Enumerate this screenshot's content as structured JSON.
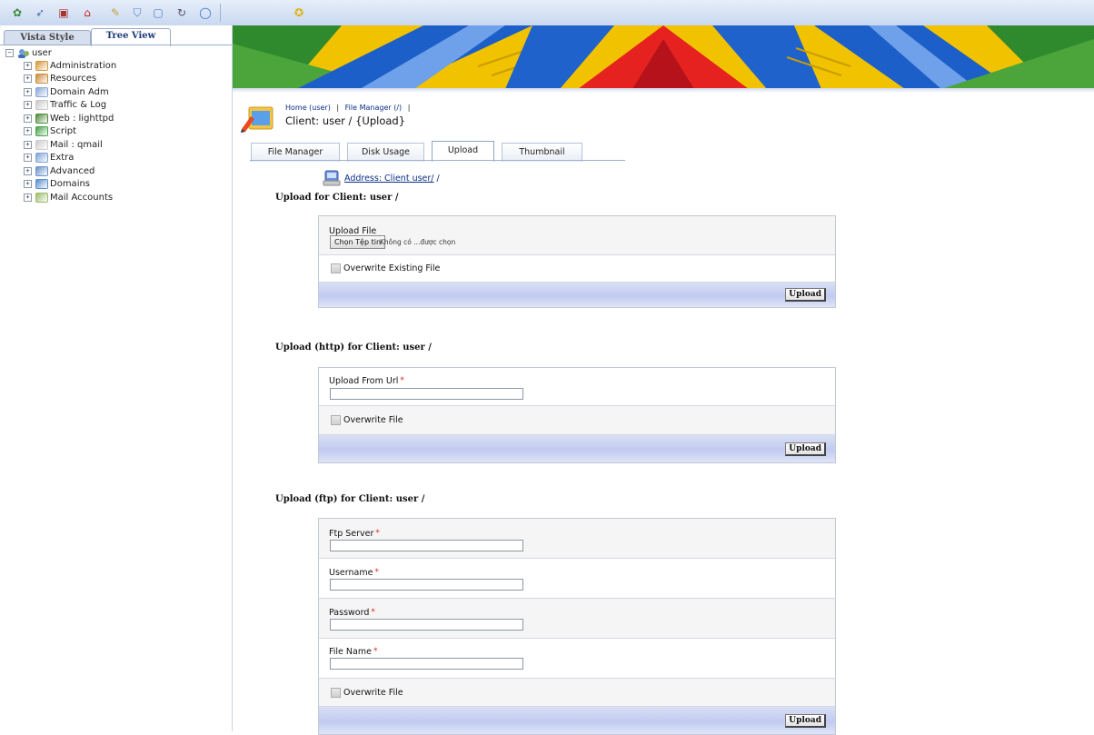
{
  "toolbar": {
    "icons": [
      "tree-icon",
      "bird-icon",
      "lock-icon",
      "home-icon",
      "pin-icon",
      "shield-icon",
      "refresh-icon",
      "globe-icon",
      "star-icon"
    ]
  },
  "sidebar": {
    "tabs": [
      "Vista Style",
      "Tree View"
    ],
    "root_label": "user",
    "items": [
      {
        "label": "Administration",
        "icon": "people-icon",
        "color": "#d6993a"
      },
      {
        "label": "Resources",
        "icon": "resources-icon",
        "color": "#c98b3a"
      },
      {
        "label": "Domain Adm",
        "icon": "domain-icon",
        "color": "#8aa8d8"
      },
      {
        "label": "Traffic & Log",
        "icon": "document-icon",
        "color": "#c8c8c8"
      },
      {
        "label": "Web : lighttpd",
        "icon": "web-icon",
        "color": "#4f8b3a"
      },
      {
        "label": "Script",
        "icon": "script-icon",
        "color": "#46a24a"
      },
      {
        "label": "Mail : qmail",
        "icon": "mail-icon",
        "color": "#cccccc"
      },
      {
        "label": "Extra",
        "icon": "extra-icon",
        "color": "#7fa4d8"
      },
      {
        "label": "Advanced",
        "icon": "advanced-icon",
        "color": "#6a92c9"
      },
      {
        "label": "Domains",
        "icon": "domains-icon",
        "color": "#5a8fd1"
      },
      {
        "label": "Mail Accounts",
        "icon": "mail-accounts-icon",
        "color": "#9dbb6b"
      }
    ]
  },
  "breadcrumb": {
    "home": "Home (user)",
    "sep": "|",
    "file_manager": "File Manager (/)",
    "trail_end": "|",
    "title": "Client: user / {Upload}"
  },
  "tabs": [
    "File Manager",
    "Disk Usage",
    "Upload",
    "Thumbnail"
  ],
  "active_tab": "Upload",
  "address": {
    "link": "Address: Client user/",
    "suffix": "/"
  },
  "upload_file": {
    "title": "Upload for Client: user /",
    "field_label": "Upload File",
    "file_button": "Chọn Tệp tin",
    "file_status": "Không có ...được chọn",
    "overwrite_label": "Overwrite Existing File",
    "submit": "Upload"
  },
  "upload_http": {
    "title": "Upload (http) for Client: user /",
    "url_label": "Upload From Url",
    "required_mark": "*",
    "url_value": "",
    "overwrite_label": "Overwrite File",
    "submit": "Upload"
  },
  "upload_ftp": {
    "title": "Upload (ftp) for Client: user /",
    "server_label": "Ftp Server",
    "username_label": "Username",
    "password_label": "Password",
    "filename_label": "File Name",
    "required_mark": "*",
    "overwrite_label": "Overwrite File",
    "submit": "Upload"
  }
}
